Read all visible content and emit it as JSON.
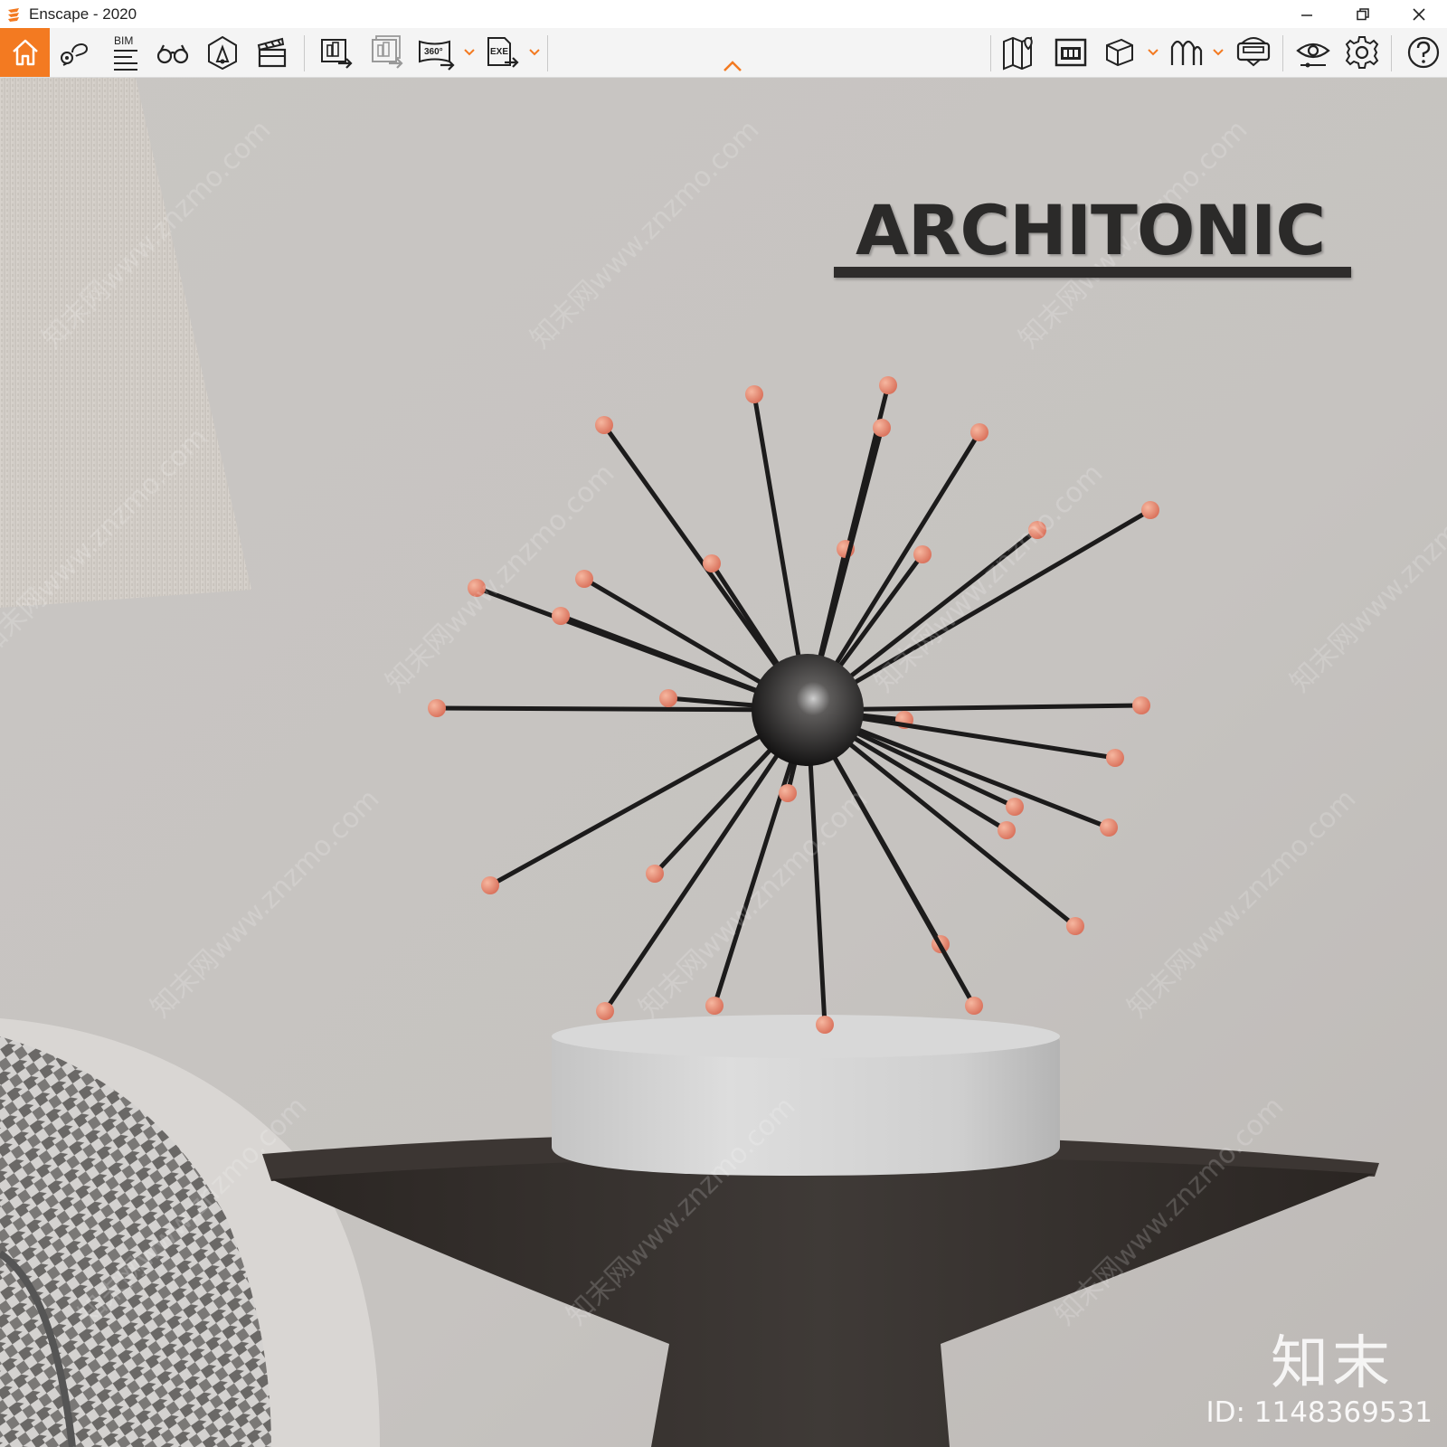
{
  "window": {
    "title": "Enscape - 2020",
    "controls": [
      "minimize-icon",
      "restore-icon",
      "close-icon"
    ]
  },
  "toolbar": {
    "accent_color": "#f37a21",
    "left_tools": [
      {
        "name": "home",
        "icon": "home-icon"
      },
      {
        "name": "views",
        "icon": "location-pin-icon"
      },
      {
        "name": "bim",
        "icon": "bim-info-icon",
        "label": "BIM"
      },
      {
        "name": "binoculars",
        "icon": "binoculars-icon"
      },
      {
        "name": "asset-library",
        "icon": "asset-library-icon"
      },
      {
        "name": "video-editor",
        "icon": "clapperboard-icon"
      }
    ],
    "export_tools": [
      {
        "name": "screenshot",
        "icon": "render-export-icon"
      },
      {
        "name": "batch-render",
        "icon": "batch-render-icon"
      },
      {
        "name": "panorama",
        "icon": "panorama-360-icon",
        "label": "360°"
      },
      {
        "name": "exe-export",
        "icon": "exe-export-icon",
        "label": "EXE"
      }
    ],
    "right_tools": [
      {
        "name": "map",
        "icon": "map-icon"
      },
      {
        "name": "mini-map",
        "icon": "mini-map-icon"
      },
      {
        "name": "view-mode",
        "icon": "cube-icon"
      },
      {
        "name": "collaborative",
        "icon": "people-icon"
      },
      {
        "name": "vr-headset",
        "icon": "vr-headset-icon"
      },
      {
        "name": "visual-settings",
        "icon": "eye-settings-icon"
      },
      {
        "name": "general-settings",
        "icon": "gear-icon"
      },
      {
        "name": "help",
        "icon": "help-icon"
      }
    ]
  },
  "scene": {
    "brand_text": "ARCHITONIC",
    "watermark_brand": "知末",
    "watermark_id": "ID: 1148369531",
    "watermark_repeat": "知末网www.znzmo.com",
    "tip_color": "#e8876a",
    "rod_color": "#1c1b1b"
  }
}
